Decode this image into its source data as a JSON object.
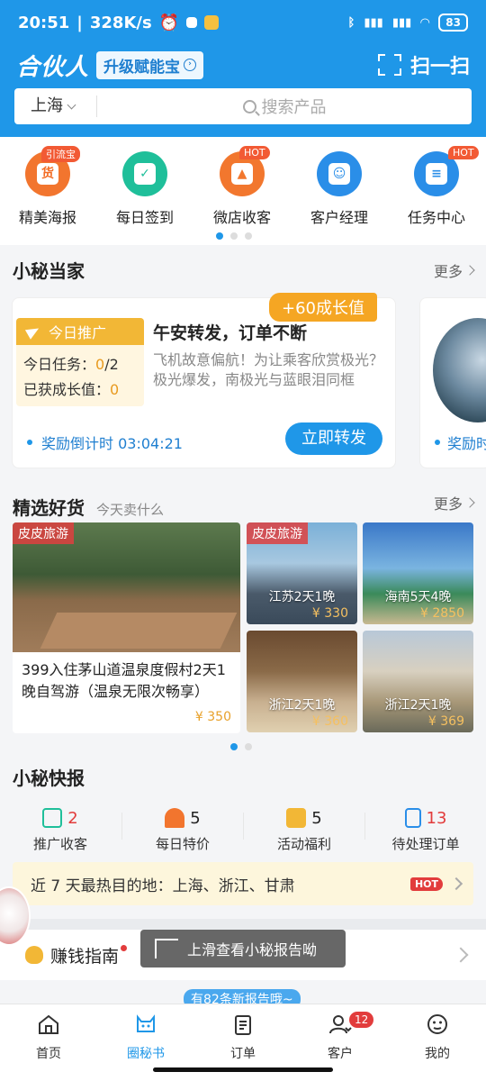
{
  "status": {
    "time": "20:51",
    "speed": "328K/s",
    "battery": "83"
  },
  "brand": {
    "logo": "合伙人",
    "upgrade": "升级赋能宝",
    "scan": "扫一扫"
  },
  "search": {
    "city": "上海",
    "placeholder": "搜索产品"
  },
  "quick": [
    {
      "label": "精美海报",
      "badge": "引流宝",
      "color": "#f2752e",
      "glyph": "货"
    },
    {
      "label": "每日签到",
      "badge": "",
      "color": "#1fbf9a",
      "glyph": "✓"
    },
    {
      "label": "微店收客",
      "badge": "HOT",
      "color": "#f2772e",
      "glyph": "▲"
    },
    {
      "label": "客户经理",
      "badge": "",
      "color": "#2a8ee8",
      "glyph": "☺"
    },
    {
      "label": "任务中心",
      "badge": "HOT",
      "color": "#2a8ee8",
      "glyph": "≡"
    }
  ],
  "xiaomi": {
    "title": "小秘当家",
    "more": "更多",
    "growth": "+60成长值",
    "promo_title": "今日推广",
    "task_label": "今日任务：",
    "task_done": "0",
    "task_total": "/2",
    "earned_label": "已获成长值：",
    "earned": "0",
    "card_title": "午安转发，订单不断",
    "card_desc": "飞机故意偏航！为让乘客欣赏极光？极光爆发，南极光与蓝眼泪同框",
    "countdown": "奖励倒计时 03:04:21",
    "forward": "立即转发",
    "next_countdown": "奖励时"
  },
  "goods": {
    "title": "精选好货",
    "subtitle": "今天卖什么",
    "more": "更多",
    "main": {
      "tag": "皮皮旅游",
      "name": "399入住茅山道温泉度假村2天1晚自驾游（温泉无限次畅享）",
      "price": "¥ 350"
    },
    "items": [
      {
        "tag": "皮皮旅游",
        "name": "江苏2天1晚",
        "price": "¥ 330"
      },
      {
        "tag": "",
        "name": "海南5天4晚",
        "price": "¥ 2850"
      },
      {
        "tag": "",
        "name": "浙江2天1晚",
        "price": "¥ 360"
      },
      {
        "tag": "",
        "name": "浙江2天1晚",
        "price": "¥ 369"
      }
    ]
  },
  "report": {
    "title": "小秘快报",
    "stats": [
      {
        "label": "推广收客",
        "value": "2",
        "red": true,
        "color": "#1fbf9a"
      },
      {
        "label": "每日特价",
        "value": "5",
        "red": false,
        "color": "#f2752e"
      },
      {
        "label": "活动福利",
        "value": "5",
        "red": false,
        "color": "#f2b736"
      },
      {
        "label": "待处理订单",
        "value": "13",
        "red": true,
        "color": "#2a8ee8"
      }
    ],
    "hot_text": "近 7 天最热目的地：上海、浙江、甘肃",
    "hot_badge": "HOT"
  },
  "guide": {
    "label": "赚钱指南",
    "toast": "上滑查看小秘报告呦",
    "new_reports": "有82条新报告哦~"
  },
  "tabs": [
    {
      "label": "首页",
      "active": false
    },
    {
      "label": "圈秘书",
      "active": true
    },
    {
      "label": "订单",
      "active": false
    },
    {
      "label": "客户",
      "active": false,
      "badge": "12"
    },
    {
      "label": "我的",
      "active": false
    }
  ]
}
